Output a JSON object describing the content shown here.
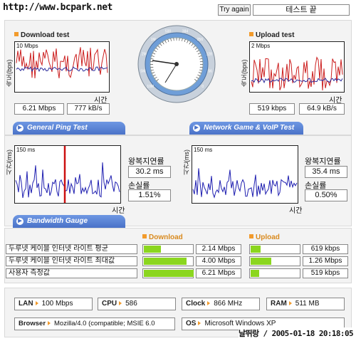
{
  "watermark": "http://www.bcpark.net",
  "header": {
    "retry_label": "Try again",
    "status_label": "테스트 끝"
  },
  "download": {
    "title": "Download test",
    "scale": "10 Mbps",
    "ylabel": "속도(bps)",
    "xlabel": "시간",
    "mbps": "6.21 Mbps",
    "kbs": "777 kB/s",
    "color_bg": "#f3f3f3"
  },
  "upload": {
    "title": "Upload test",
    "scale": "2 Mbps",
    "ylabel": "속도(bps)",
    "xlabel": "시간",
    "kbps": "519 kbps",
    "kbs": "64.9 kB/s"
  },
  "tabs": {
    "ping": "General Ping Test",
    "game": "Network Game & VoIP Test",
    "bandwidth": "Bandwidth Gauge"
  },
  "ping": {
    "scale": "150 ms",
    "ylabel": "시간(ms)",
    "xlabel": "시간",
    "latency_label": "왕복지연률",
    "latency": "30.2 ms",
    "loss_label": "손실률",
    "loss": "1.51%"
  },
  "game": {
    "scale": "150 ms",
    "ylabel": "시간(ms)",
    "xlabel": "시간",
    "latency_label": "왕복지연률",
    "latency": "35.4 ms",
    "loss_label": "손실률",
    "loss": "0.50%"
  },
  "bandwidth": {
    "download_header": "Download",
    "upload_header": "Upload",
    "rows": [
      {
        "label": "두루넷 케이블 인터넷 라이트 평균",
        "down": "2.14 Mbps",
        "down_level": 0.34,
        "up": "619 kbps",
        "up_level": 0.2
      },
      {
        "label": "두루넷 케이블 인터넷 라이트 최대값",
        "down": "4.00 Mbps",
        "down_level": 0.85,
        "up": "1.26 Mbps",
        "up_level": 0.42
      },
      {
        "label": "사용자 측정값",
        "down": "6.21 Mbps",
        "down_level": 1.0,
        "up": "519 kbps",
        "up_level": 0.17
      }
    ]
  },
  "sysinfo": {
    "lan_label": "LAN",
    "lan": "100 Mbps",
    "cpu_label": "CPU",
    "cpu": "586",
    "clock_label": "Clock",
    "clock": "866 MHz",
    "ram_label": "RAM",
    "ram": "511 MB",
    "browser_label": "Browser",
    "browser": "Mozilla/4.0 (compatible; MSIE 6.0",
    "os_label": "OS",
    "os": "Microsoft Windows XP"
  },
  "footer_stamp": "날뛰랑 / 2005-01-18 20:18:05",
  "gauge": {
    "ticks": [
      "10M",
      "5M",
      "2M",
      "1M",
      "500",
      "384",
      "256",
      "128",
      "56",
      "0"
    ]
  }
}
